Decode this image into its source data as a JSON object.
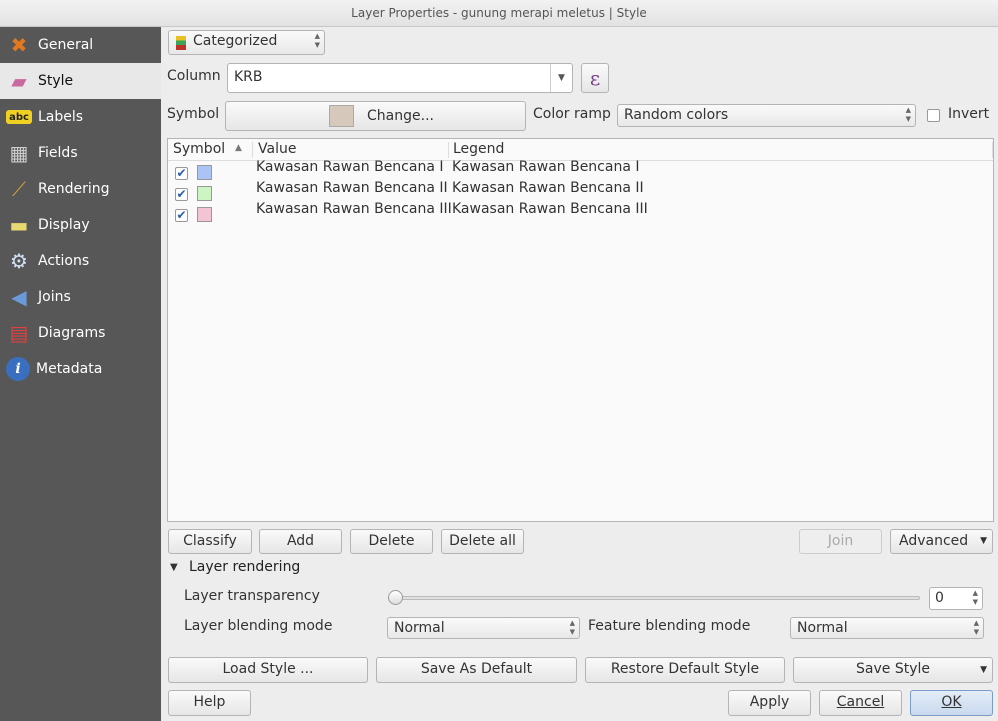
{
  "window": {
    "title": "Layer Properties - gunung merapi meletus | Style"
  },
  "sidebar": {
    "items": [
      {
        "label": "General",
        "icon": "tools-icon"
      },
      {
        "label": "Style",
        "icon": "paintbrush-icon",
        "selected": true
      },
      {
        "label": "Labels",
        "icon": "abc-label-icon"
      },
      {
        "label": "Fields",
        "icon": "table-icon"
      },
      {
        "label": "Rendering",
        "icon": "brush-icon"
      },
      {
        "label": "Display",
        "icon": "speech-bubble-icon"
      },
      {
        "label": "Actions",
        "icon": "gear-play-icon"
      },
      {
        "label": "Joins",
        "icon": "join-icon"
      },
      {
        "label": "Diagrams",
        "icon": "chart-icon"
      },
      {
        "label": "Metadata",
        "icon": "info-icon"
      }
    ]
  },
  "renderer": {
    "type": "Categorized"
  },
  "column": {
    "label": "Column",
    "value": "KRB"
  },
  "symbol": {
    "label": "Symbol",
    "change_label": "Change...",
    "color": "#d6c9bc"
  },
  "color_ramp": {
    "label": "Color ramp",
    "value": "Random colors",
    "invert_label": "Invert",
    "invert_checked": false
  },
  "table": {
    "headers": [
      "Symbol",
      "Value",
      "Legend"
    ],
    "rows": [
      {
        "checked": true,
        "color": "#a9c4f5",
        "value": "Kawasan Rawan Bencana I",
        "legend": "Kawasan Rawan Bencana I"
      },
      {
        "checked": true,
        "color": "#cdf5c4",
        "value": "Kawasan Rawan Bencana II",
        "legend": "Kawasan Rawan Bencana II"
      },
      {
        "checked": true,
        "color": "#f5c4d4",
        "value": "Kawasan Rawan Bencana III",
        "legend": "Kawasan Rawan Bencana III"
      }
    ]
  },
  "buttons": {
    "classify": "Classify",
    "add": "Add",
    "delete": "Delete",
    "delete_all": "Delete all",
    "join": "Join",
    "advanced": "Advanced"
  },
  "layer_rendering": {
    "title": "Layer rendering",
    "transparency_label": "Layer transparency",
    "transparency_value": "0",
    "blending_label": "Layer blending mode",
    "blending_value": "Normal",
    "feature_blending_label": "Feature blending mode",
    "feature_blending_value": "Normal"
  },
  "style_buttons": {
    "load": "Load Style ...",
    "save_default": "Save As Default",
    "restore": "Restore Default Style",
    "save": "Save Style"
  },
  "footer": {
    "help": "Help",
    "apply": "Apply",
    "cancel": "Cancel",
    "ok": "OK"
  }
}
